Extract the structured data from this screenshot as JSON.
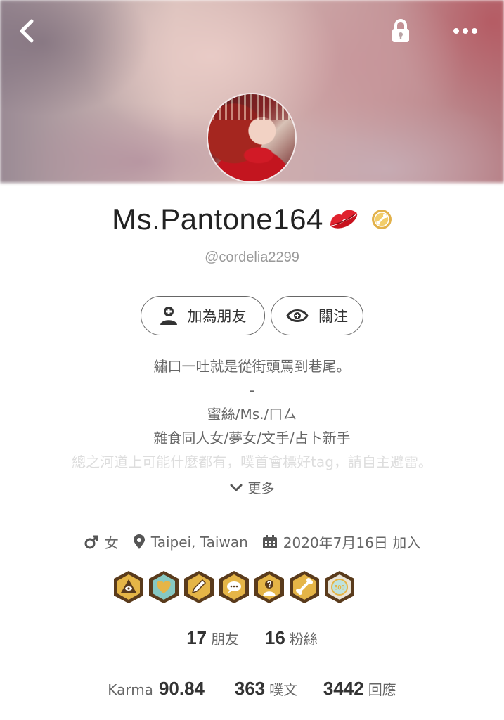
{
  "profile": {
    "display_name": "Ms.Pantone164",
    "handle": "@cordelia2299"
  },
  "actions": {
    "add_friend": "加為朋友",
    "follow": "關注"
  },
  "bio": {
    "lines": [
      "繡口一吐就是從街頭罵到巷尾。",
      "-",
      "蜜絲/Ms./ㄇㄙ",
      "雜食同人女/夢女/文手/占卜新手",
      "總之河道上可能什麼都有，噗首會標好tag，請自主避雷。"
    ],
    "more_label": "更多"
  },
  "info": {
    "gender": "女",
    "location": "Taipei, Taiwan",
    "joined": "2020年7月16日 加入"
  },
  "badges": [
    "eye-badge",
    "heart-badge",
    "pencil-badge",
    "chat-badge",
    "question-badge",
    "bone-badge",
    "500-badge"
  ],
  "badge_500_text": "500",
  "stats": {
    "friends_count": "17",
    "friends_label": "朋友",
    "fans_count": "16",
    "fans_label": "粉絲",
    "karma_label": "Karma",
    "karma_value": "90.84",
    "plurks_count": "363",
    "plurks_label": "噗文",
    "responses_count": "3442",
    "responses_label": "回應"
  },
  "colors": {
    "badge_brown": "#5a3b1c",
    "badge_gold": "#e5b547",
    "lips_red": "#e0222e"
  }
}
